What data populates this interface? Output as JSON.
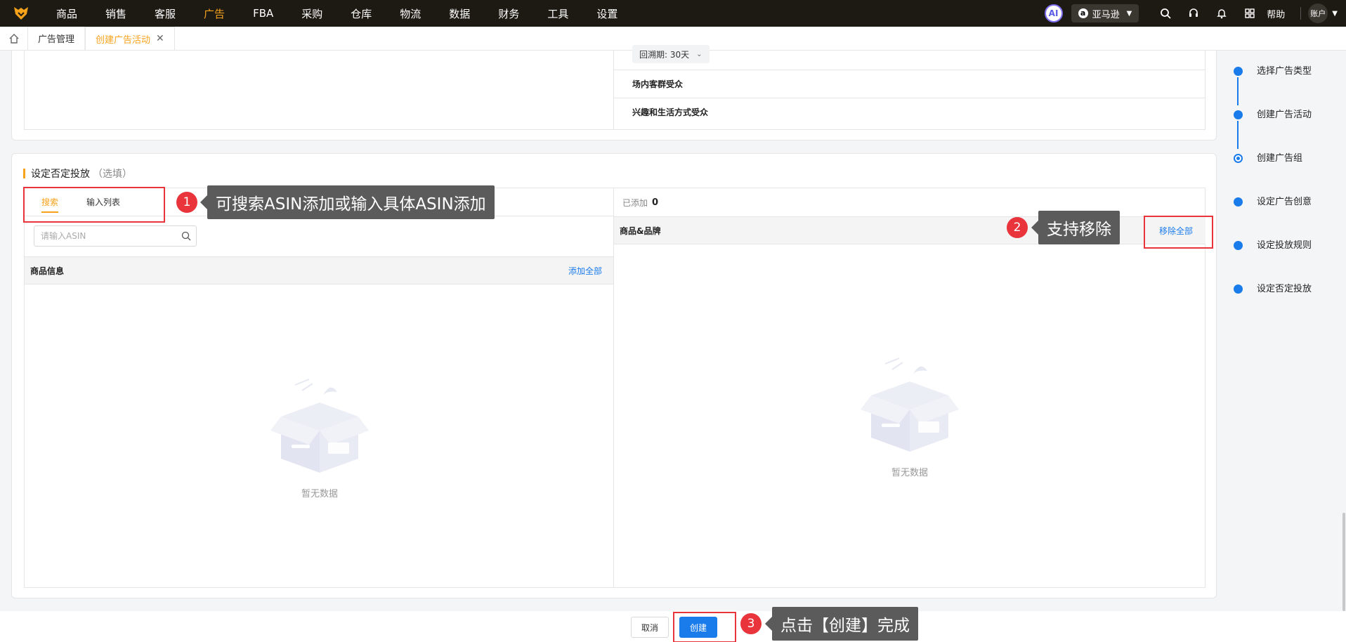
{
  "topnav": {
    "items": [
      "商品",
      "销售",
      "客服",
      "广告",
      "FBA",
      "采购",
      "仓库",
      "物流",
      "数据",
      "财务",
      "工具",
      "设置"
    ],
    "active_index": 3,
    "ai_label": "AI",
    "store_label": "亚马逊",
    "help_label": "帮助",
    "account_label": "账户"
  },
  "tabs": {
    "items": [
      "广告管理",
      "创建广告活动"
    ],
    "close_label": "✕"
  },
  "top_panel": {
    "lookback_label": "回溯期: 30天",
    "audience_rows": [
      "场内客群受众",
      "兴趣和生活方式受众"
    ]
  },
  "negative_section": {
    "title": "设定否定投放",
    "optional": "（选填）",
    "tabs": [
      "搜索",
      "输入列表"
    ],
    "search_placeholder": "请输入ASIN",
    "left_header": "商品信息",
    "add_all": "添加全部",
    "added_label": "已添加",
    "added_count": "0",
    "right_header": "商品&品牌",
    "remove_all": "移除全部",
    "empty_text": "暂无数据"
  },
  "steps": {
    "items": [
      "选择广告类型",
      "创建广告活动",
      "创建广告组",
      "设定广告创意",
      "设定投放规则",
      "设定否定投放"
    ],
    "current_index": 2
  },
  "footer": {
    "cancel": "取消",
    "create": "创建"
  },
  "annotations": [
    {
      "num": "1",
      "text": "可搜索ASIN添加或输入具体ASIN添加"
    },
    {
      "num": "2",
      "text": "支持移除"
    },
    {
      "num": "3",
      "text": "点击【创建】完成"
    }
  ],
  "colors": {
    "accent": "#f7a21b",
    "primary": "#1a7bea",
    "annotation_red": "#e8343a",
    "callout_gray": "#5b5b5b"
  }
}
